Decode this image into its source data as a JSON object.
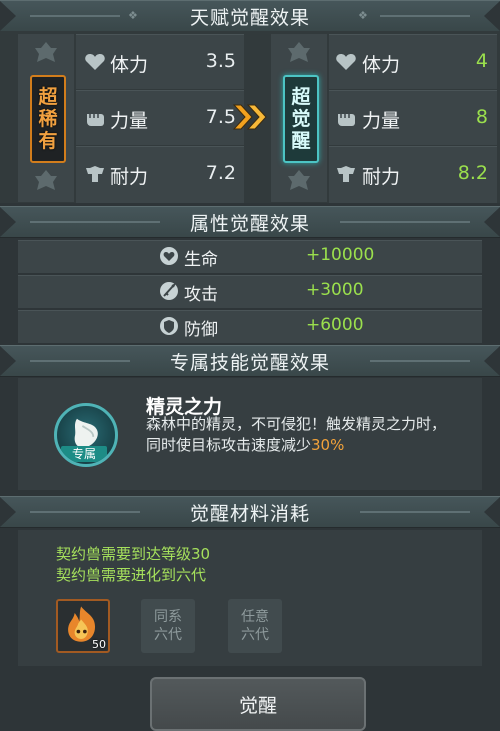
{
  "talent_section": {
    "title": "天赋觉醒效果",
    "left_badge": [
      "超",
      "稀",
      "有"
    ],
    "right_badge": [
      "超",
      "觉",
      "醒"
    ],
    "left_stats": [
      {
        "label": "体力",
        "value": "3.5"
      },
      {
        "label": "力量",
        "value": "7.5"
      },
      {
        "label": "耐力",
        "value": "7.2"
      }
    ],
    "right_stats": [
      {
        "label": "体力",
        "value": "4"
      },
      {
        "label": "力量",
        "value": "8"
      },
      {
        "label": "耐力",
        "value": "8.2"
      }
    ]
  },
  "attribute_section": {
    "title": "属性觉醒效果",
    "rows": [
      {
        "label": "生命",
        "value": "+10000"
      },
      {
        "label": "攻击",
        "value": "+3000"
      },
      {
        "label": "防御",
        "value": "+6000"
      }
    ]
  },
  "skill_section": {
    "title": "专属技能觉醒效果",
    "skill_tag": "专属",
    "skill_name": "精灵之力",
    "desc_line1": "森林中的精灵，不可侵犯！触发精灵之力时，",
    "desc_line2_prefix": "同时使目标攻击速度减少",
    "desc_highlight": "30%"
  },
  "material_section": {
    "title": "觉醒材料消耗",
    "req1": "契约兽需要到达等级30",
    "req2": "契约兽需要进化到六代",
    "item_count": "50",
    "slot2": [
      "同系",
      "六代"
    ],
    "slot3": [
      "任意",
      "六代"
    ]
  },
  "awaken_button": "觉醒",
  "colors": {
    "green": "#9be04d",
    "orange": "#f2a23a",
    "badge_orange": "#d27d1c",
    "badge_cyan": "#4cc4c4"
  }
}
